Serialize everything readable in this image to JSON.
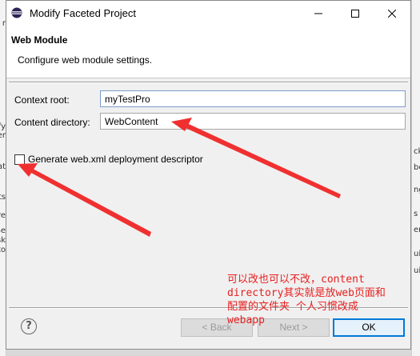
{
  "background": {
    "left_fragments": [
      "r",
      "fy",
      "er",
      "at",
      "ts",
      "re",
      "Se",
      "sk",
      "to"
    ],
    "right_fragments": [
      "ck",
      "be",
      "ng",
      "s",
      "ent",
      "ui",
      "ui"
    ]
  },
  "window": {
    "title": "Modify Faceted Project",
    "minimize_icon": "minimize-icon",
    "maximize_icon": "maximize-icon",
    "close_icon": "close-icon"
  },
  "banner": {
    "title": "Web Module",
    "description": "Configure web module settings."
  },
  "form": {
    "context_root_label": "Context root:",
    "context_root_value": "myTestPro",
    "content_dir_label": "Content directory:",
    "content_dir_value": "WebContent",
    "generate_xml_label": "Generate web.xml deployment descriptor",
    "generate_xml_checked": false
  },
  "buttons": {
    "help_icon": "help-icon",
    "help_glyph": "?",
    "back": "< Back",
    "next": "Next >",
    "ok": "OK"
  },
  "annotation": {
    "color": "#e82020",
    "lines": [
      "可以改也可以不改，content",
      "directory其实就是放web页面和",
      "配置的文件夹 个人习惯改成",
      "webapp"
    ]
  },
  "colors": {
    "accent": "#0078d7",
    "annotation": "#e82020",
    "field_focus_border": "#7a9cc9"
  }
}
